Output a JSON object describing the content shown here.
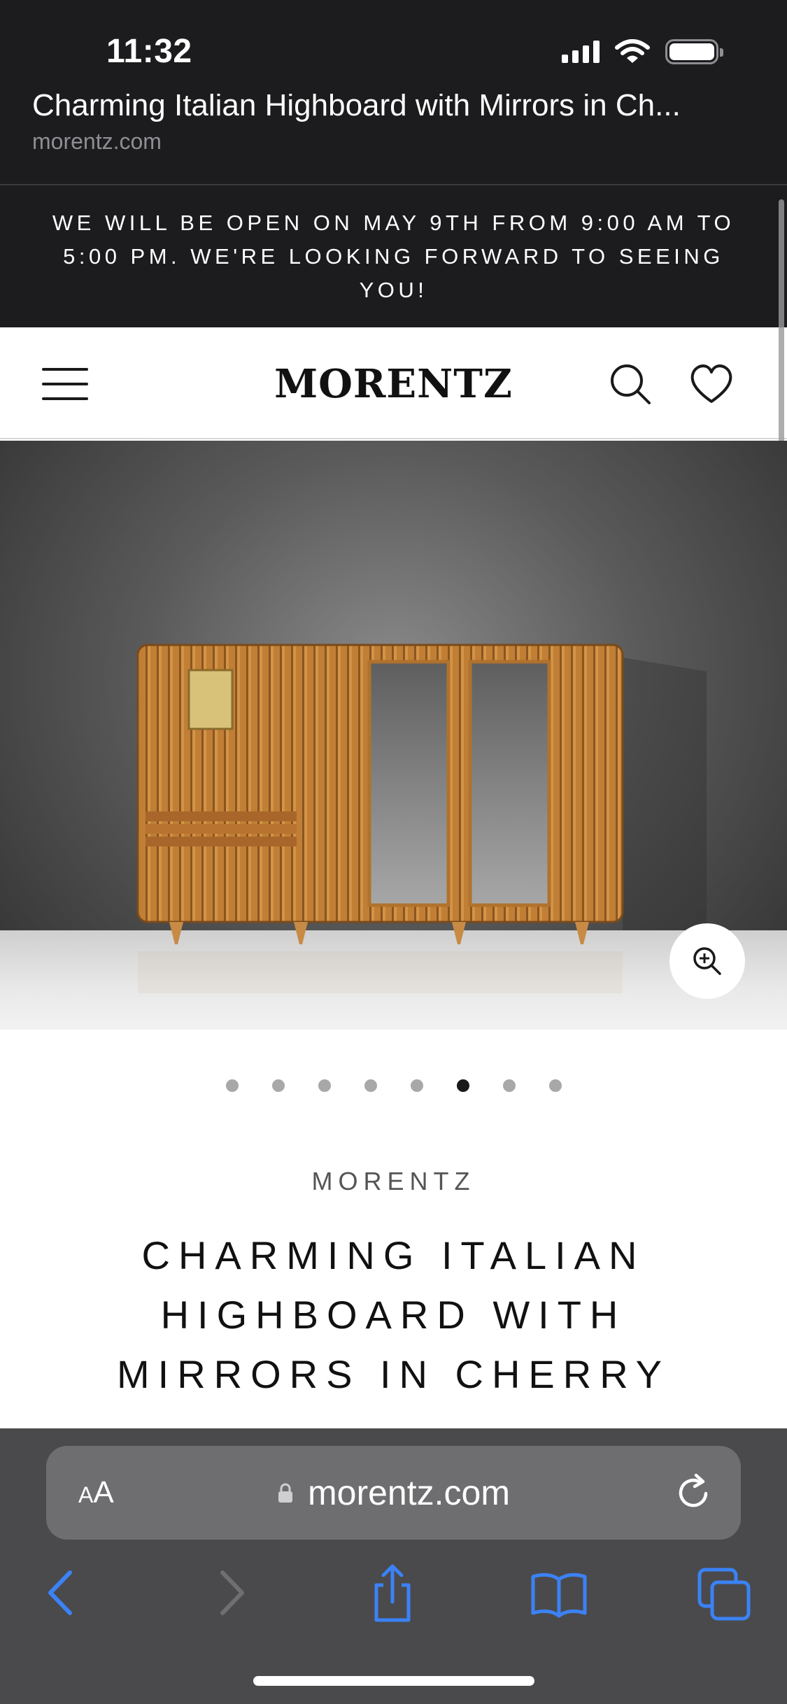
{
  "status_bar": {
    "time": "11:32"
  },
  "browser_header": {
    "page_title": "Charming Italian Highboard with Mirrors in Ch...",
    "domain": "morentz.com"
  },
  "banner": {
    "text": "WE WILL BE OPEN ON MAY 9TH FROM 9:00 AM TO 5:00 PM. WE'RE LOOKING FORWARD TO SEEING YOU!"
  },
  "site_header": {
    "logo": "MORENTZ",
    "menu_icon": "hamburger-menu-icon",
    "search_icon": "search-icon",
    "wishlist_icon": "heart-icon"
  },
  "gallery": {
    "zoom_icon": "zoom-in-icon",
    "dot_count": 8,
    "active_dot_index": 5
  },
  "product": {
    "brand": "MORENTZ",
    "title": "CHARMING ITALIAN HIGHBOARD WITH MIRRORS IN CHERRY"
  },
  "safari": {
    "text_size_label": "AA",
    "url": "morentz.com",
    "icons": [
      "back-icon",
      "forward-icon",
      "share-icon",
      "bookmarks-icon",
      "tabs-icon"
    ]
  },
  "colors": {
    "dark_bg": "#1c1c1e",
    "safari_blue": "#3b82f6",
    "wood": "#b8782e"
  }
}
